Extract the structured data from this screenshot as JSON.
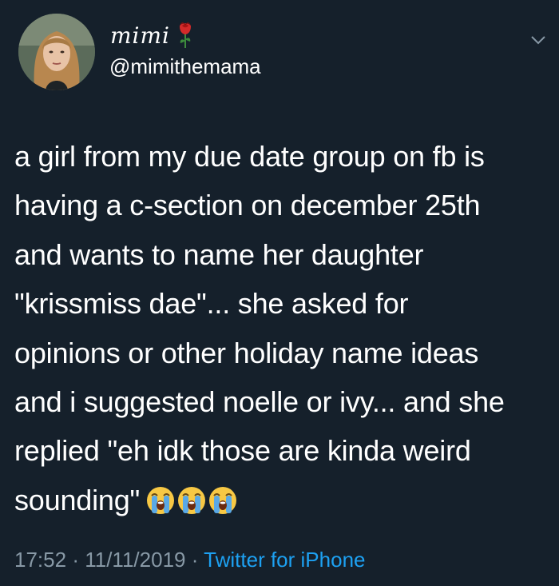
{
  "tweet": {
    "display_name": "mimi",
    "name_emoji": "rose-icon",
    "handle": "@mimithemama",
    "text_lines": [
      "a girl from my due date group on fb is",
      "having a c-section on december 25th",
      "and wants to name her daughter",
      "\"krissmiss dae\"... she asked for",
      "opinions or other holiday name ideas",
      "and i suggested noelle or ivy... and she",
      "replied \"eh idk those are kinda weird",
      "sounding\""
    ],
    "trailing_emojis": [
      "loudly-crying-face-icon",
      "loudly-crying-face-icon",
      "loudly-crying-face-icon"
    ],
    "time": "17:52",
    "separator": "·",
    "date": "11/11/2019",
    "source": "Twitter for iPhone"
  },
  "colors": {
    "background": "#15202b",
    "text": "#ffffff",
    "meta_text": "#8899a6",
    "link": "#1da1f2"
  }
}
